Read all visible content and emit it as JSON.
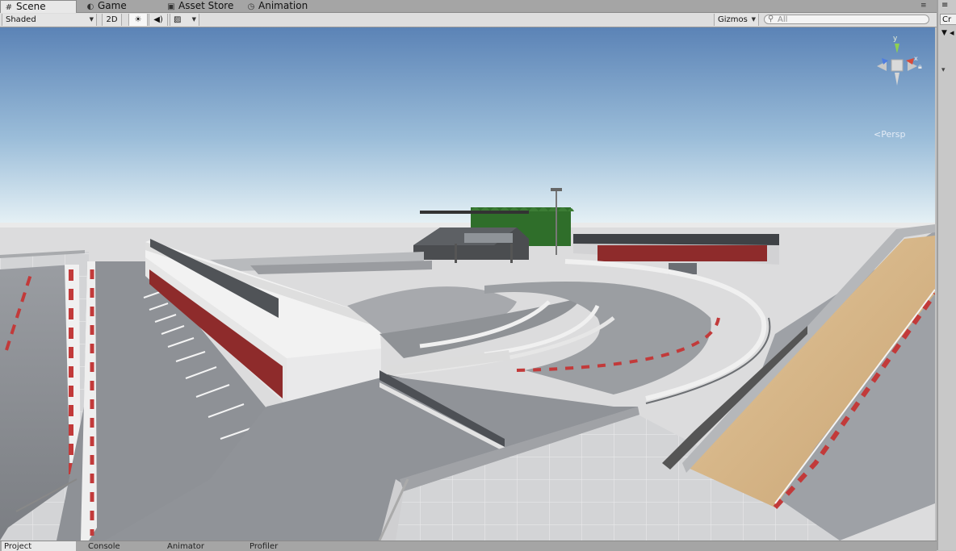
{
  "tabs": [
    {
      "label": "Scene",
      "icon": "grid-icon",
      "active": true
    },
    {
      "label": "Game",
      "icon": "pacman-icon"
    },
    {
      "label": "Asset Store",
      "icon": "bag-icon"
    },
    {
      "label": "Animation",
      "icon": "clock-icon"
    }
  ],
  "toolbar": {
    "draw_mode": "Shaded",
    "mode_2d": "2D",
    "lighting_icon": "sun-icon",
    "audio_icon": "speaker-icon",
    "effects_icon": "image-icon",
    "gizmos": "Gizmos",
    "search_placeholder": "All"
  },
  "gizmo": {
    "projection": "Persp",
    "y_axis": "y",
    "x_axis": "x",
    "lock_icon": "lock-icon"
  },
  "right_panel": {
    "tab_label": "Cr"
  },
  "bottom_tabs": [
    {
      "label": "Project",
      "active": true
    },
    {
      "label": "Console"
    },
    {
      "label": "Animator"
    },
    {
      "label": "Profiler"
    }
  ],
  "colors": {
    "sky_top": "#5f86b8",
    "sky_horizon": "#e8f2f6",
    "ground": "#d9dadc",
    "asphalt": "#8c8f95",
    "curb_red": "#c23a3a",
    "sand": "#d9b888",
    "trees": "#2f6e2a"
  }
}
